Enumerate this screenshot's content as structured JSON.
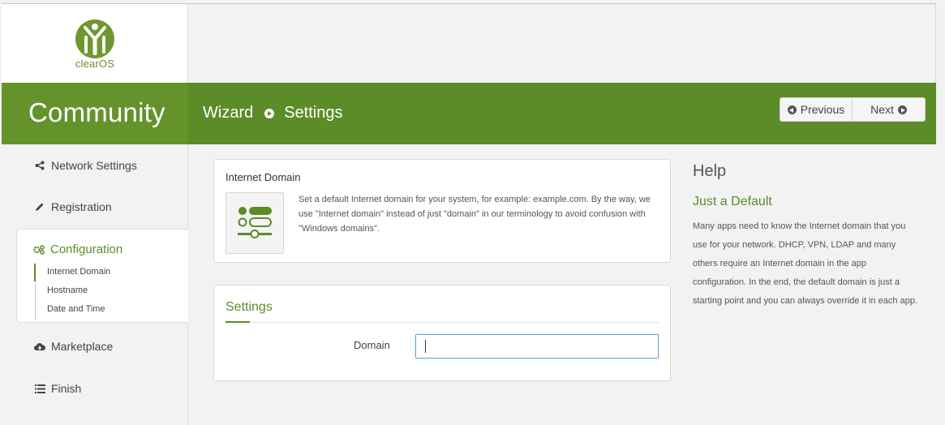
{
  "branding": {
    "logo_text": "clearOS",
    "edition": "Community",
    "brand_green": "#5b8c27"
  },
  "breadcrumb": {
    "parent": "Wizard",
    "current": "Settings"
  },
  "nav_buttons": {
    "previous": "Previous",
    "next": "Next"
  },
  "sidebar": {
    "items": [
      {
        "label": "Network Settings",
        "icon": "share-icon"
      },
      {
        "label": "Registration",
        "icon": "pencil-icon"
      },
      {
        "label": "Configuration",
        "icon": "gears-icon",
        "active": true
      },
      {
        "label": "Marketplace",
        "icon": "cloud-download-icon"
      },
      {
        "label": "Finish",
        "icon": "list-icon"
      }
    ],
    "sub_items": [
      "Internet Domain",
      "Hostname",
      "Date and Time"
    ]
  },
  "info_card": {
    "title": "Internet Domain",
    "description": "Set a default Internet domain for your system, for example: example.com. By the way, we use \"Internet domain\" instead of just \"domain\" in our terminology to avoid confusion with \"Windows domains\"."
  },
  "settings_card": {
    "title": "Settings",
    "domain_label": "Domain",
    "domain_value": ""
  },
  "help": {
    "heading": "Help",
    "subheading": "Just a Default",
    "text": "Many apps need to know the Internet domain that you use for your network. DHCP, VPN, LDAP and many others require an Internet domain in the app configuration. In the end, the default domain is just a starting point and you can always override it in each app."
  }
}
